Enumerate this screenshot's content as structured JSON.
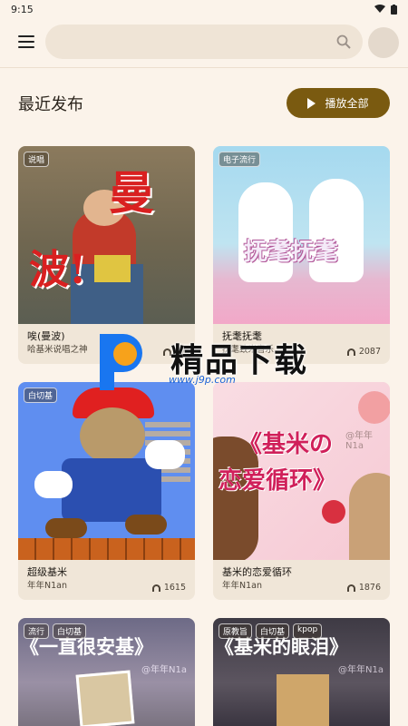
{
  "status_bar": {
    "time": "9:15"
  },
  "search": {
    "placeholder": ""
  },
  "section": {
    "title": "最近发布",
    "play_all_label": "播放全部"
  },
  "cards": [
    {
      "title": "唉(曼波)",
      "artist": "哈基米说唱之神",
      "plays": "37",
      "tags": [
        "说唱"
      ],
      "art_text": [
        "曼",
        "波!"
      ]
    },
    {
      "title": "抚耄抚耄",
      "artist": "抚耄致米音乐",
      "plays": "2087",
      "tags": [
        "电子流行"
      ],
      "art_text": [
        "抚耄抚耄"
      ]
    },
    {
      "title": "超级基米",
      "artist": "年年N1an",
      "plays": "1615",
      "tags": [
        "白切基"
      ],
      "art_text": []
    },
    {
      "title": "基米的恋爱循环",
      "artist": "年年N1an",
      "plays": "1876",
      "tags": [],
      "art_text": [
        "《基米の",
        "恋爱循环》"
      ]
    },
    {
      "title": "",
      "artist": "",
      "plays": "",
      "tags": [
        "流行",
        "白切基"
      ],
      "art_text": [
        "《一直很安基》"
      ]
    },
    {
      "title": "",
      "artist": "",
      "plays": "",
      "tags": [
        "原教旨",
        "白切基",
        "kpop"
      ],
      "art_text": [
        "《基米的眼泪》"
      ]
    }
  ],
  "watermark": {
    "brand": "精品下载",
    "url": "www.j9p.com",
    "art_handle": "@年年N1a"
  },
  "colors": {
    "background": "#fbf3ea",
    "accent": "#7a5a10",
    "card": "#f0e6d8",
    "search": "#efe4d6"
  }
}
